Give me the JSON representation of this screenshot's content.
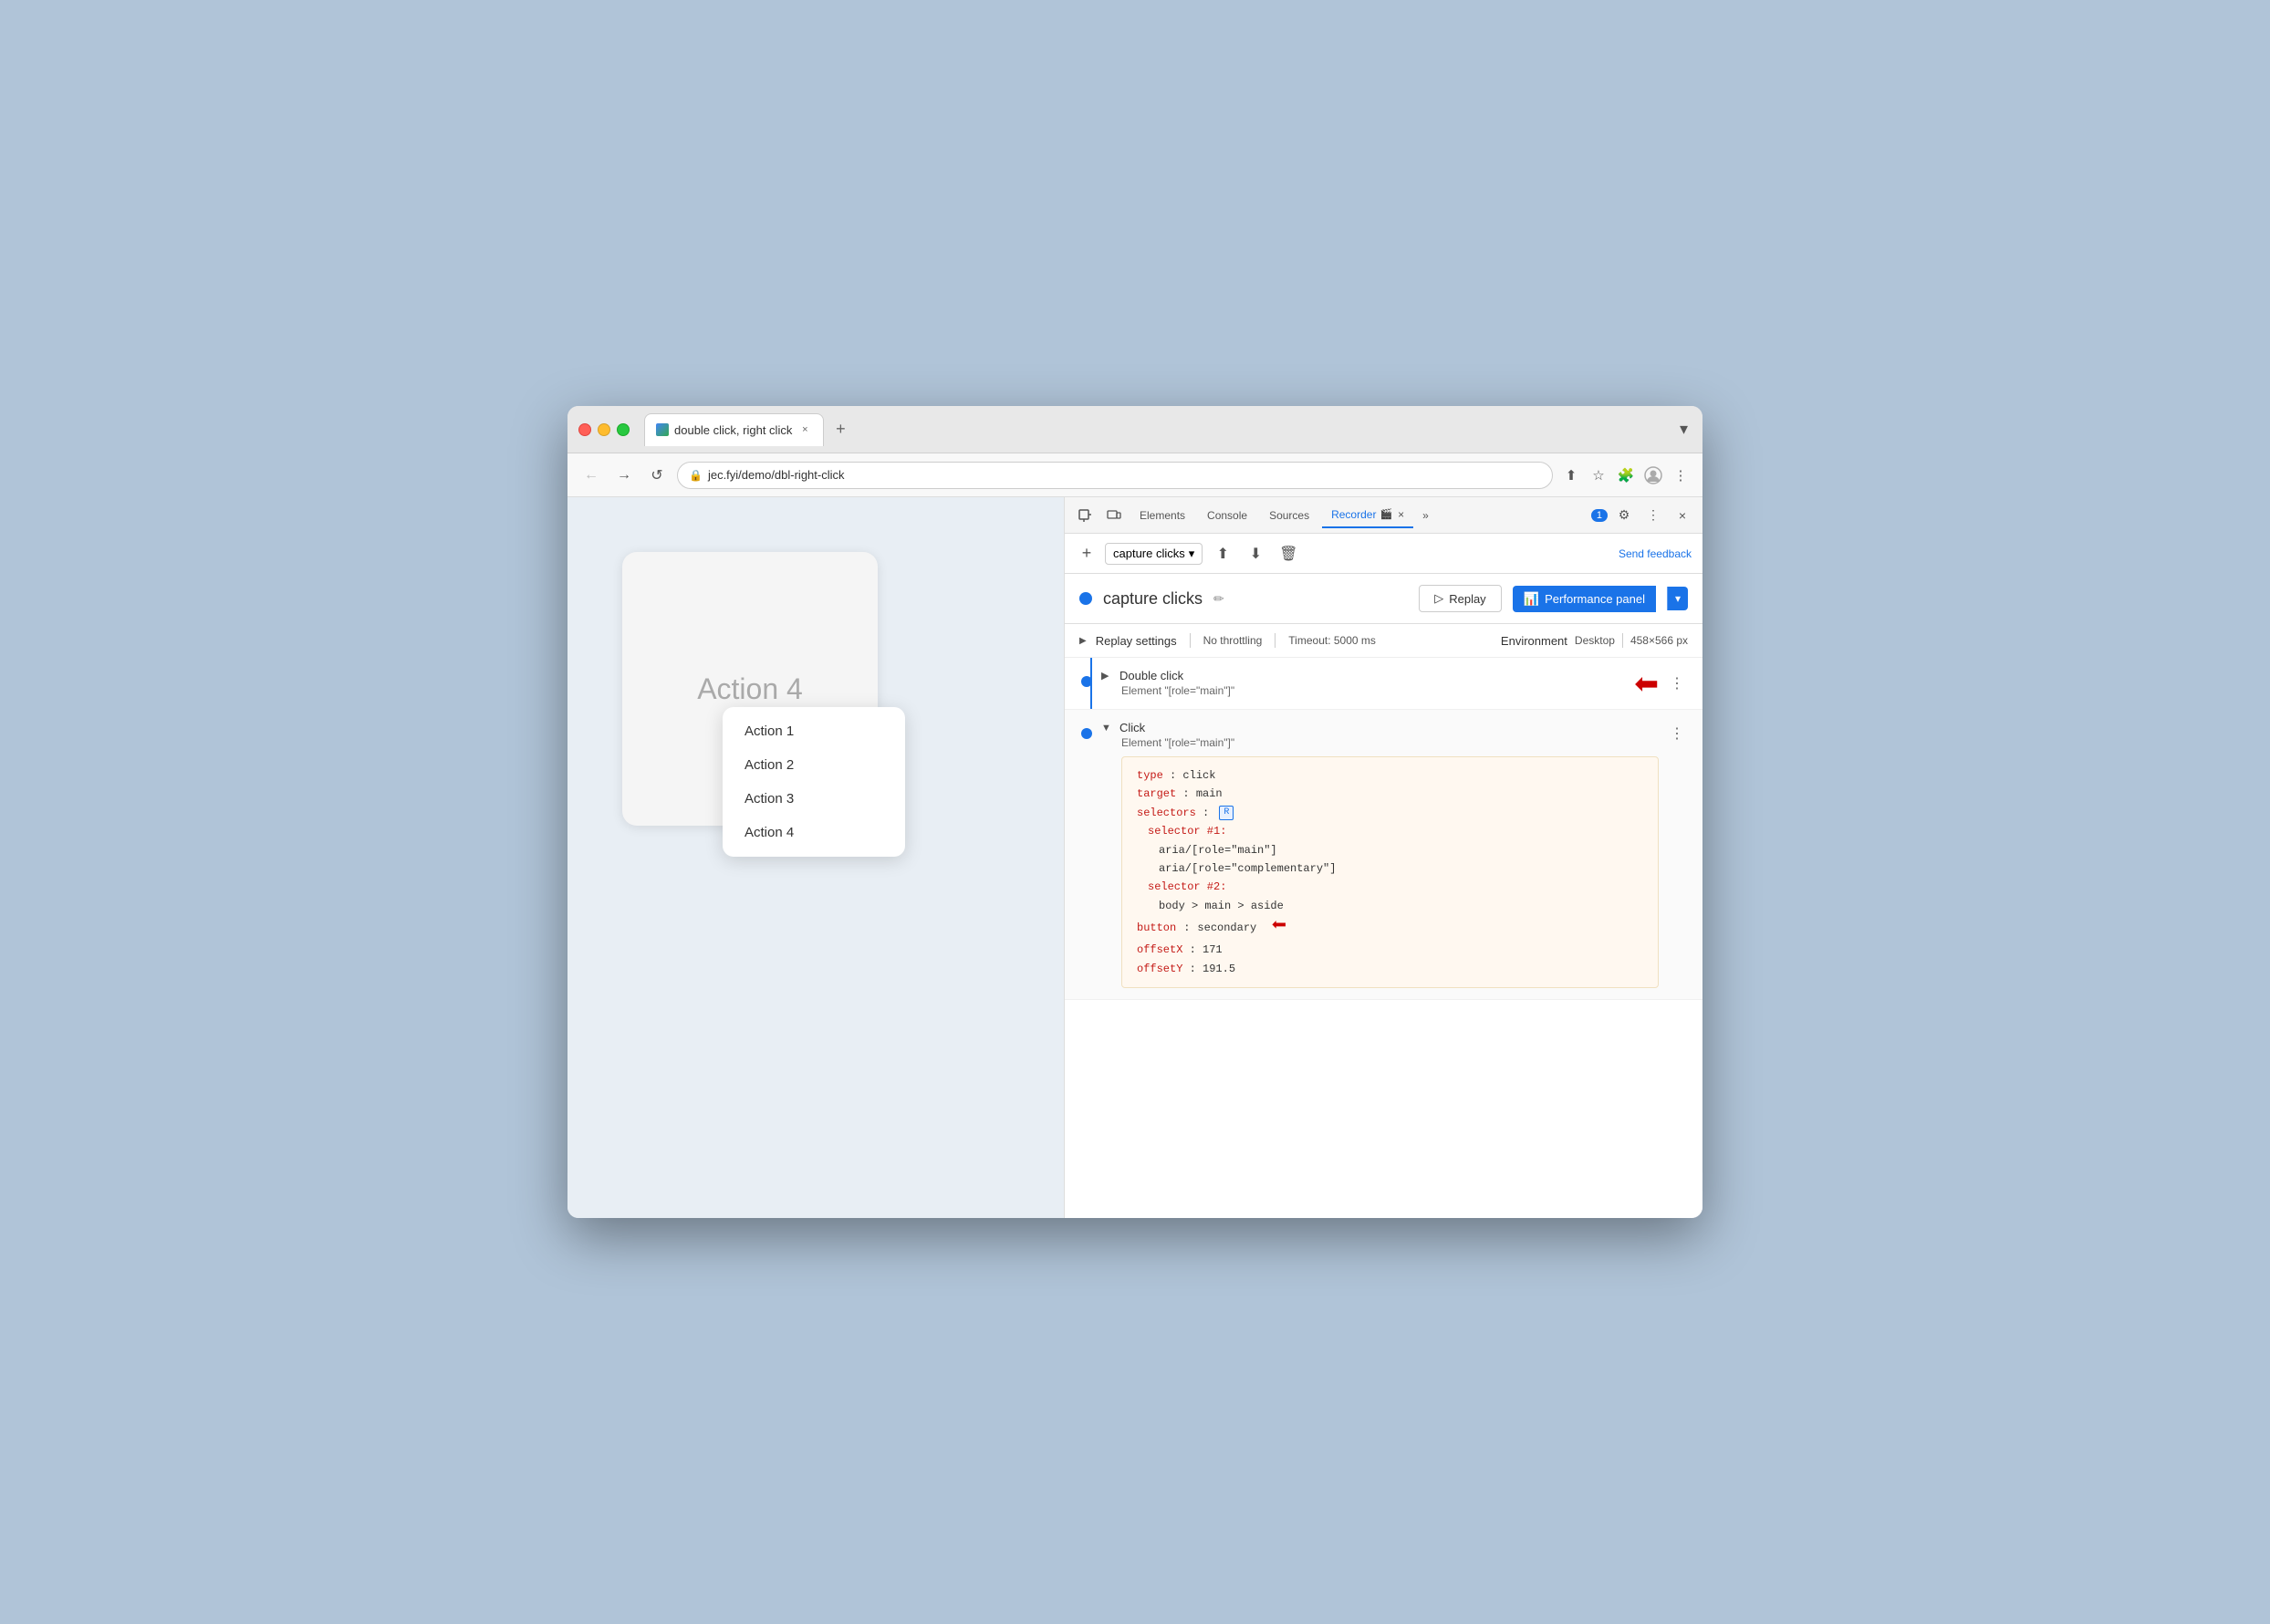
{
  "browser": {
    "tab_title": "double click, right click",
    "url": "jec.fyi/demo/dbl-right-click",
    "new_tab_label": "+"
  },
  "devtools": {
    "tabs": [
      "Elements",
      "Console",
      "Sources",
      "Recorder",
      ""
    ],
    "recorder_tab": "Recorder",
    "close_label": "×",
    "more_tabs_label": "»",
    "badge_count": "1",
    "toolbar": {
      "add_label": "+",
      "recording_name": "capture clicks",
      "send_feedback": "Send feedback"
    },
    "recording": {
      "title": "capture clicks",
      "replay_label": "Replay",
      "performance_panel_label": "Performance panel"
    },
    "replay_settings": {
      "label": "Replay settings",
      "no_throttling": "No throttling",
      "timeout": "Timeout: 5000 ms",
      "environment_label": "Environment",
      "desktop": "Desktop",
      "dimensions": "458×566 px"
    },
    "steps": [
      {
        "id": "step1",
        "toggle": "▶",
        "title": "Double click",
        "subtitle": "Element \"[role=\"main\"]\"",
        "expanded": false,
        "has_arrow": true
      },
      {
        "id": "step2",
        "toggle": "▼",
        "title": "Click",
        "subtitle": "Element \"[role=\"main\"]\"",
        "expanded": true,
        "has_arrow": false
      }
    ],
    "code": {
      "type_key": "type",
      "type_val": "click",
      "target_key": "target",
      "target_val": "main",
      "selectors_key": "selectors",
      "selector_icon": "R",
      "selector1_key": "selector #1:",
      "aria1": "aria/[role=\"main\"]",
      "aria2": "aria/[role=\"complementary\"]",
      "selector2_key": "selector #2:",
      "body_sel": "body > main > aside",
      "button_key": "button",
      "button_val": "secondary",
      "offsetX_key": "offsetX",
      "offsetX_val": "171",
      "offsetY_key": "offsetY",
      "offsetY_val": "191.5"
    }
  },
  "page": {
    "big_card_text": "Action 4",
    "menu_items": [
      "Action 1",
      "Action 2",
      "Action 3",
      "Action 4"
    ]
  },
  "icons": {
    "back": "←",
    "forward": "→",
    "reload": "↺",
    "lock": "🔒",
    "share": "⬆",
    "bookmark": "☆",
    "extension": "🧩",
    "account": "👤",
    "menu": "⋮",
    "inspect": "⬚",
    "device": "⬛",
    "more_tabs": "»",
    "gear": "⚙",
    "three_dot": "⋮",
    "close": "×",
    "collapse": "⊠",
    "play": "▷",
    "edit": "✏",
    "chevron_down": "▾",
    "upload": "⬆",
    "download": "⬇",
    "trash": "🗑",
    "maximize": "⊡"
  }
}
